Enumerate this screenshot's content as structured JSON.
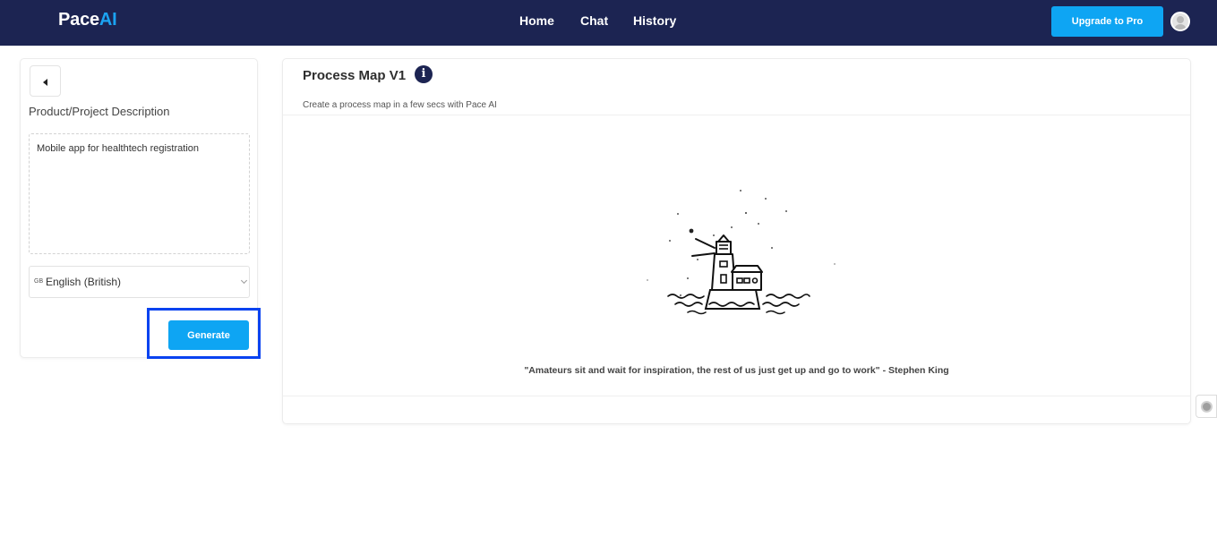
{
  "navbar": {
    "logo_main": "Pace",
    "logo_accent": "AI",
    "links": {
      "home": "Home",
      "chat": "Chat",
      "history": "History"
    },
    "upgrade_label": "Upgrade to Pro"
  },
  "left_panel": {
    "field_label": "Product/Project Description",
    "description_value": "Mobile app for healthtech registration",
    "language": {
      "flag": "GB",
      "selected": "English (British)"
    },
    "generate_label": "Generate"
  },
  "right_panel": {
    "title": "Process Map V1",
    "info_glyph": "i",
    "subtitle": "Create a process map in a few secs with Pace AI",
    "quote": "\"Amateurs sit and wait for inspiration, the rest of us just get up and go to work\" - Stephen King"
  },
  "colors": {
    "navbar_bg": "#1c2452",
    "accent": "#0ea5f3",
    "highlight": "#0a43f0"
  },
  "icons": [
    "back-arrow-icon",
    "info-icon",
    "chevron-down-icon",
    "lighthouse-illustration",
    "avatar-icon",
    "help-widget-icon"
  ]
}
